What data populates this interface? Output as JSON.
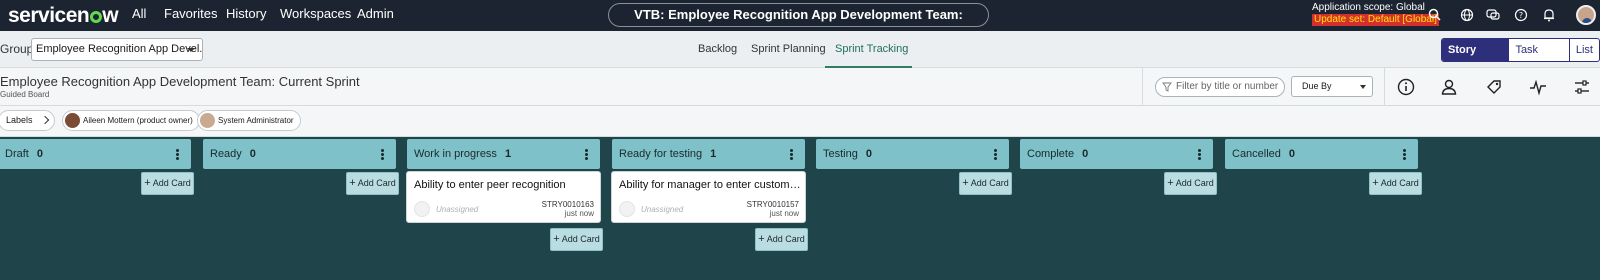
{
  "topnav": {
    "logo": "servicenow",
    "items": [
      "All",
      "Favorites",
      "History",
      "Workspaces",
      "Admin"
    ],
    "title": "VTB: Employee Recognition App Development Team: Current Sprint",
    "scope": "Application scope: Global",
    "update_set": "Update set: Default [Global]",
    "icons": [
      "search-icon",
      "globe-icon",
      "chat-icon",
      "help-icon",
      "bell-icon",
      "user-avatar"
    ]
  },
  "subheader": {
    "group_label": "Group",
    "group_value": "Employee Recognition App Devel...",
    "tabs": [
      "Backlog",
      "Sprint Planning",
      "Sprint Tracking"
    ],
    "active_tab": "Sprint Tracking",
    "views": [
      "Story board",
      "Task board",
      "List"
    ],
    "active_view": "Story board"
  },
  "board_header": {
    "title": "Employee Recognition App Development Team: Current Sprint",
    "subtitle": "Guided Board",
    "filter_placeholder": "Filter by title or number",
    "sort_value": "Due By",
    "tool_icons": [
      "info-icon",
      "person-icon",
      "tag-icon",
      "activity-icon",
      "settings-sliders-icon"
    ]
  },
  "labels_row": {
    "labels_button": "Labels",
    "people": [
      "Aileen Mottern (product owner)",
      "System Administrator"
    ]
  },
  "columns": [
    {
      "name": "Draft",
      "count": "0"
    },
    {
      "name": "Ready",
      "count": "0"
    },
    {
      "name": "Work in progress",
      "count": "1"
    },
    {
      "name": "Ready for testing",
      "count": "1"
    },
    {
      "name": "Testing",
      "count": "0"
    },
    {
      "name": "Complete",
      "count": "0"
    },
    {
      "name": "Cancelled",
      "count": "0"
    }
  ],
  "add_card_label": "Add Card",
  "cards": [
    {
      "title": "Ability to enter peer recognition",
      "assignee": "Unassigned",
      "number": "STRY0010163",
      "updated": "just now"
    },
    {
      "title": "Ability for manager to enter customer/i...",
      "assignee": "Unassigned",
      "number": "STRY0010157",
      "updated": "just now"
    }
  ],
  "colors": {
    "nav_bg": "#1b2430",
    "board_bg": "#1f4449",
    "column_header": "#7ec1c9",
    "active_tab": "#2f7d67",
    "view_selected": "#2e2f7a"
  }
}
